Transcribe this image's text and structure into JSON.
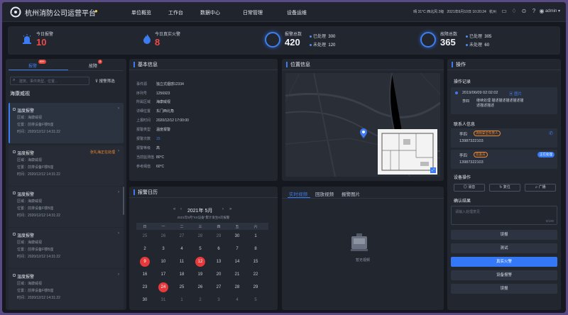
{
  "app": {
    "title": "杭州消防公司运营平台"
  },
  "nav": [
    "单位概览",
    "工作台",
    "数据中心",
    "日常管理",
    "设备运维"
  ],
  "topright": {
    "weather": "晴   31°C   西北风 2级",
    "datetime": "2021年6月10日 10:20:24",
    "location": "杭州",
    "user": "admin"
  },
  "stats": {
    "today_alarm": {
      "label": "今日报警",
      "value": "10"
    },
    "today_fire": {
      "label": "今日真实火警",
      "value": "8"
    },
    "alarm_total": {
      "label": "报警总数",
      "value": "420",
      "handled_label": "已处理",
      "handled": "300",
      "unhandled_label": "未处理",
      "unhandled": "120"
    },
    "fault_total": {
      "label": "故障总数",
      "value": "365",
      "handled_label": "已处理",
      "handled": "305",
      "unhandled_label": "未处理",
      "unhandled": "60"
    }
  },
  "left": {
    "tabs": [
      {
        "label": "报警",
        "badge": "99+"
      },
      {
        "label": "故障",
        "badge": "9"
      }
    ],
    "filter_label": "报警筛选",
    "search_placeholder": "建筑、事件类型、位置...",
    "company": "海康威视",
    "alarms": [
      {
        "title": "温度报警",
        "area": "区域：海康威视",
        "pos": "位置：前排设备F楼B座",
        "time": "时间：2020/12/12 14:31:22",
        "status": ""
      },
      {
        "title": "温度报警",
        "area": "区域：海康威视",
        "pos": "位置：前排设备F楼B座",
        "time": "时间：2020/12/12 14:31:22",
        "status": "张礼海正在处理"
      },
      {
        "title": "温度报警",
        "area": "区域：海康威视",
        "pos": "位置：前排设备F楼B座",
        "time": "时间：2020/12/12 14:31:22",
        "status": ""
      },
      {
        "title": "温度报警",
        "area": "区域：海康威视",
        "pos": "位置：前排设备F楼B座",
        "time": "时间：2020/12/12 14:31:22",
        "status": ""
      },
      {
        "title": "温度报警",
        "area": "区域：海康威视",
        "pos": "位置：前排设备F楼B座",
        "time": "时间：2020/12/12 14:31:22",
        "status": ""
      }
    ]
  },
  "basic": {
    "title": "基本信息",
    "rows": [
      {
        "k": "事件源",
        "v": "独立式烟感12334"
      },
      {
        "k": "序列号",
        "v": "1256923"
      },
      {
        "k": "所属区域",
        "v": "海康威视"
      },
      {
        "k": "详细位置",
        "v": "东门西北角"
      },
      {
        "k": "上报时间",
        "v": "2020/12/12 17:00:00"
      },
      {
        "k": "报警类型",
        "v": "温度报警"
      },
      {
        "k": "报警次数",
        "v": "15"
      },
      {
        "k": "报警等级",
        "v": "高"
      },
      {
        "k": "当前监测值",
        "v": "80°C"
      },
      {
        "k": "参考阈值",
        "v": "60°C"
      }
    ]
  },
  "calendar": {
    "title": "报警日历",
    "month": "2021年  5月",
    "nav": {
      "prev_year": "«",
      "prev_month": "‹",
      "next_month": "›",
      "next_year": "»"
    },
    "subtitle": "2021年5月\"XX设备\"累计发生8次报警",
    "weekdays": [
      "日",
      "一",
      "二",
      "三",
      "四",
      "五",
      "六"
    ],
    "days": [
      "25",
      "26",
      "27",
      "28",
      "29",
      "30",
      "1",
      "2",
      "3",
      "4",
      "5",
      "6",
      "7",
      "8",
      "9",
      "10",
      "11",
      "12",
      "13",
      "14",
      "15",
      "16",
      "17",
      "18",
      "19",
      "20",
      "21",
      "22",
      "23",
      "24",
      "25",
      "26",
      "27",
      "28",
      "29",
      "30",
      "31",
      "1",
      "2",
      "3",
      "4",
      "5"
    ],
    "highlighted": [
      "9",
      "12",
      "24"
    ]
  },
  "location": {
    "title": "位置信息"
  },
  "video": {
    "tabs": [
      "实时视频",
      "回放视频",
      "报警图片"
    ],
    "empty": "暂无视频"
  },
  "ops": {
    "title": "操作",
    "record_title": "操作记录",
    "record": {
      "time": "2019/06/09 02:02:02",
      "link": "图片",
      "user": "李四",
      "text": "继续处理 描述描述描述描述描述描述描述"
    },
    "contacts_title": "联系人信息",
    "contacts": [
      {
        "name": "李四",
        "tag": "消防安全负责人",
        "phone": "13987322103"
      },
      {
        "name": "李四",
        "tag": "巡查员",
        "phone": "13987322103",
        "badge": "正在处理"
      }
    ],
    "device_title": "设备操作",
    "device_buttons": [
      "消音",
      "复位",
      "广播"
    ],
    "confirm_title": "确认结果",
    "placeholder": "请输入处理意见",
    "counter": "0/100",
    "results": [
      "误报",
      "测试",
      "真实火警",
      "设备报警",
      "误报"
    ]
  }
}
